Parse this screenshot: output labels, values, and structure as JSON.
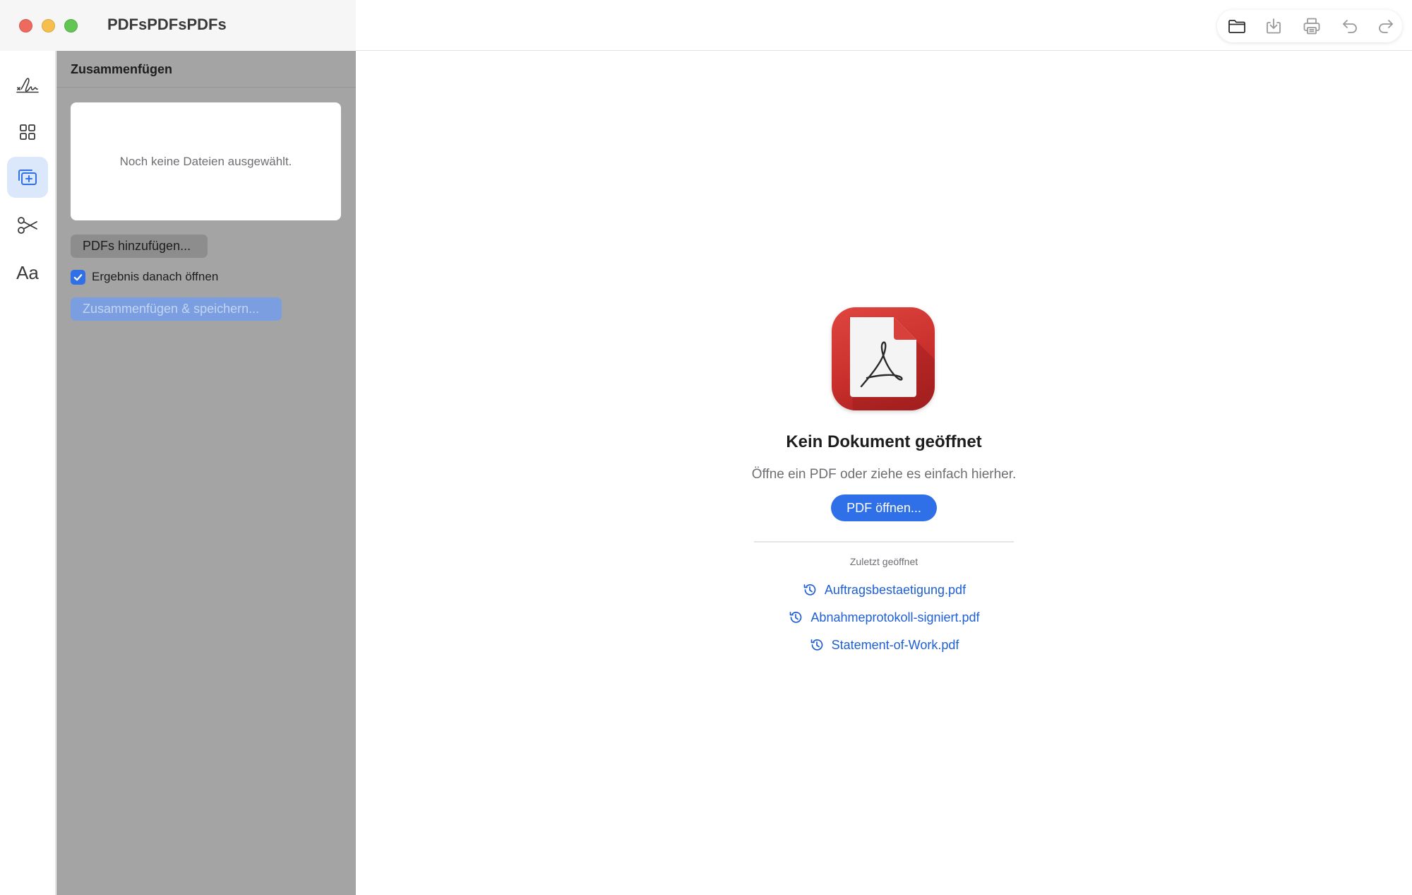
{
  "app": {
    "title": "PDFsPDFsPDFs"
  },
  "toolbar": {
    "buttons": [
      {
        "name": "open-folder",
        "icon": "folder-icon"
      },
      {
        "name": "save",
        "icon": "download-icon"
      },
      {
        "name": "print",
        "icon": "printer-icon"
      },
      {
        "name": "undo",
        "icon": "undo-icon"
      },
      {
        "name": "redo",
        "icon": "redo-icon"
      }
    ]
  },
  "rail": {
    "items": [
      {
        "name": "sign",
        "icon": "signature-icon"
      },
      {
        "name": "pages",
        "icon": "grid-icon"
      },
      {
        "name": "merge",
        "icon": "merge-icon",
        "active": true
      },
      {
        "name": "split",
        "icon": "scissors-icon"
      },
      {
        "name": "text",
        "label": "Aa"
      }
    ]
  },
  "panel": {
    "title": "Zusammenfügen",
    "empty_text": "Noch keine Dateien ausgewählt.",
    "add_label": "PDFs hinzufügen...",
    "open_after_label": "Ergebnis danach öffnen",
    "open_after_checked": true,
    "merge_label": "Zusammenfügen & speichern..."
  },
  "main": {
    "empty_title": "Kein Dokument geöffnet",
    "empty_subtitle": "Öffne ein PDF oder ziehe es einfach hierher.",
    "open_label": "PDF öffnen...",
    "recent_label": "Zuletzt geöffnet",
    "recent_files": [
      "Auftragsbestaetigung.pdf",
      "Abnahmeprotokoll-signiert.pdf",
      "Statement-of-Work.pdf"
    ]
  },
  "colors": {
    "accent": "#2f6fe8",
    "link": "#1e5fd6",
    "panel_bg": "#a4a4a4",
    "logo_red": "#c92f2c"
  }
}
